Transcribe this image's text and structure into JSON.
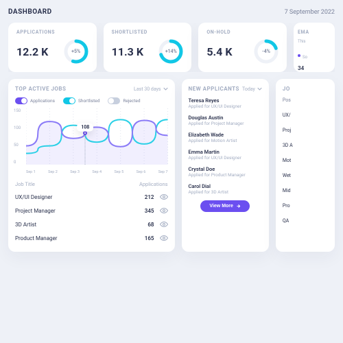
{
  "header": {
    "title": "DASHBOARD",
    "date": "7 September 2022"
  },
  "stats": [
    {
      "label": "APPLICATIONS",
      "value": "12.2 K",
      "delta": "+5%",
      "delta_pct": 55,
      "color": "#11c7e6"
    },
    {
      "label": "SHORTLISTED",
      "value": "11.3 K",
      "delta": "+14%",
      "delta_pct": 70,
      "color": "#11c7e6"
    },
    {
      "label": "ON-HOLD",
      "value": "5.4 K",
      "delta": "-4%",
      "delta_pct": 20,
      "color": "#11c7e6"
    }
  ],
  "stats_cut": {
    "label": "EMA",
    "sub": "This",
    "bullet": "So",
    "num": "34"
  },
  "active_jobs": {
    "title": "TOP ACTIVE JOBS",
    "range": "Last 30 days",
    "toggles": [
      {
        "label": "Applications",
        "state": "on",
        "color": "purple"
      },
      {
        "label": "Shortlisted",
        "state": "on",
        "color": "cyan"
      },
      {
        "label": "Rejected",
        "state": "off",
        "color": "grey"
      }
    ],
    "tooltip_value": "108",
    "columns": {
      "title": "Job Title",
      "apps": "Applications"
    },
    "rows": [
      {
        "title": "UX/UI Designer",
        "apps": "212"
      },
      {
        "title": "Project Manager",
        "apps": "345"
      },
      {
        "title": "3D Artist",
        "apps": "68"
      },
      {
        "title": "Product Manager",
        "apps": "165"
      }
    ]
  },
  "chart_data": {
    "type": "line",
    "title": "Top Active Jobs",
    "xlabel": "",
    "ylabel": "",
    "ylim": [
      0,
      150
    ],
    "y_ticks": [
      150,
      100,
      50,
      0
    ],
    "categories": [
      "Sep 1",
      "Sep 2",
      "Sep 3",
      "Sep 4",
      "Sep 5",
      "Sep 6",
      "Sep 7"
    ],
    "series": [
      {
        "name": "Applications",
        "color": "#8a7af7",
        "values": [
          50,
          115,
          70,
          100,
          48,
          118,
          78
        ]
      },
      {
        "name": "Shortlisted",
        "color": "#2ad0e6",
        "values": [
          30,
          50,
          105,
          60,
          120,
          55,
          120
        ]
      }
    ],
    "highlight": {
      "index_between": [
        2,
        3
      ],
      "frac": 0.5,
      "value": 108,
      "series": "Applications"
    }
  },
  "new_applicants": {
    "title": "NEW APPLICANTS",
    "range": "Today",
    "items": [
      {
        "name": "Teresa Reyes",
        "role": "Applied for UX/UI Designer"
      },
      {
        "name": "Douglas Austin",
        "role": "Applied for Project Manager"
      },
      {
        "name": "Elizabeth Wade",
        "role": "Applied for Motion Artist"
      },
      {
        "name": "Emma Martin",
        "role": "Applied for UX/UI Designer"
      },
      {
        "name": "Crystal Doe",
        "role": "Applied for Product Manager"
      },
      {
        "name": "Carol Dial",
        "role": "Applied for 3D Artist"
      }
    ],
    "view_more": "View More"
  },
  "job_sidebar": {
    "title": "JO",
    "header": "Pos",
    "items": [
      "UX/",
      "Proj",
      "3D A",
      "Mot",
      "Wet",
      "Mid",
      "Pro",
      "QA"
    ]
  }
}
